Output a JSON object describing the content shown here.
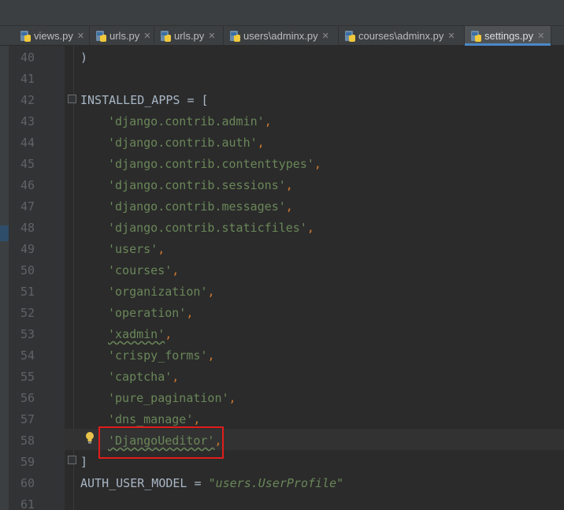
{
  "tabs": [
    {
      "label": "views.py",
      "close": "✕"
    },
    {
      "label": "urls.py",
      "close": "✕"
    },
    {
      "label": "urls.py",
      "close": "✕"
    },
    {
      "label": "users\\adminx.py",
      "close": "✕"
    },
    {
      "label": "courses\\adminx.py",
      "close": "✕"
    },
    {
      "label": "settings.py",
      "close": "✕"
    }
  ],
  "lines": {
    "n40": "40",
    "n41": "41",
    "n42": "42",
    "n43": "43",
    "n44": "44",
    "n45": "45",
    "n46": "46",
    "n47": "47",
    "n48": "48",
    "n49": "49",
    "n50": "50",
    "n51": "51",
    "n52": "52",
    "n53": "53",
    "n54": "54",
    "n55": "55",
    "n56": "56",
    "n57": "57",
    "n58": "58",
    "n59": "59",
    "n60": "60",
    "n61": "61"
  },
  "code": {
    "l40": ")",
    "l42_name": "INSTALLED_APPS",
    "l42_rest": " = [",
    "apps": [
      "'django.contrib.admin'",
      "'django.contrib.auth'",
      "'django.contrib.contenttypes'",
      "'django.contrib.sessions'",
      "'django.contrib.messages'",
      "'django.contrib.staticfiles'",
      "'users'",
      "'courses'",
      "'organization'",
      "'operation'",
      "'xadmin'",
      "'crispy_forms'",
      "'captcha'",
      "'pure_pagination'",
      "'dns_manage'",
      "'DjangoUeditor'"
    ],
    "comma": ",",
    "l59": "]",
    "l60_name": "AUTH_USER_MODEL",
    "l60_eq": " = ",
    "l60_value": "\"users.UserProfile\""
  },
  "colors": {
    "background": "#2b2b2b",
    "string": "#6a8759",
    "punctuation": "#cc7832",
    "identifier": "#a9b7c6",
    "highlight_box": "#e21c1c",
    "active_tab_underline": "#4a88c7"
  },
  "icons": {
    "tab_file": "python-file-icon",
    "intention": "lightbulb-icon"
  }
}
